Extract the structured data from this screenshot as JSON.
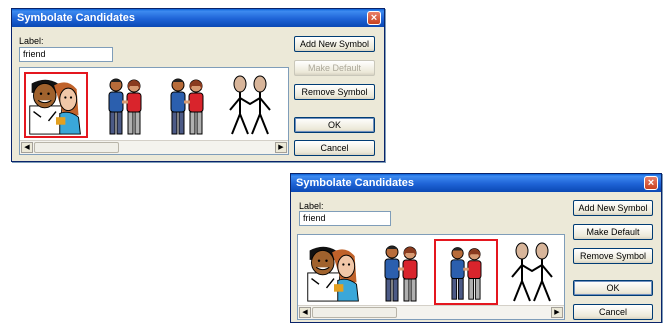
{
  "dialog1": {
    "title": "Symbolate Candidates",
    "close_glyph": "×",
    "label_caption": "Label:",
    "label_value": "friend",
    "buttons": {
      "add": "Add New Symbol",
      "make_default": "Make Default",
      "remove": "Remove Symbol",
      "ok": "OK",
      "cancel": "Cancel"
    },
    "make_default_enabled": false,
    "selected_symbol": 1
  },
  "dialog2": {
    "title": "Symbolate Candidates",
    "close_glyph": "×",
    "label_caption": "Label:",
    "label_value": "friend",
    "buttons": {
      "add": "Add New Symbol",
      "make_default": "Make Default",
      "remove": "Remove Symbol",
      "ok": "OK",
      "cancel": "Cancel"
    },
    "make_default_enabled": true,
    "selected_symbol": 3
  },
  "symbols": [
    "friends-color-photo-icon",
    "two-friends-holding-hands-icon",
    "two-friends-holding-hands-icon",
    "two-stick-friends-icon"
  ],
  "scroll_arrows": {
    "left": "◀",
    "right": "▶"
  }
}
